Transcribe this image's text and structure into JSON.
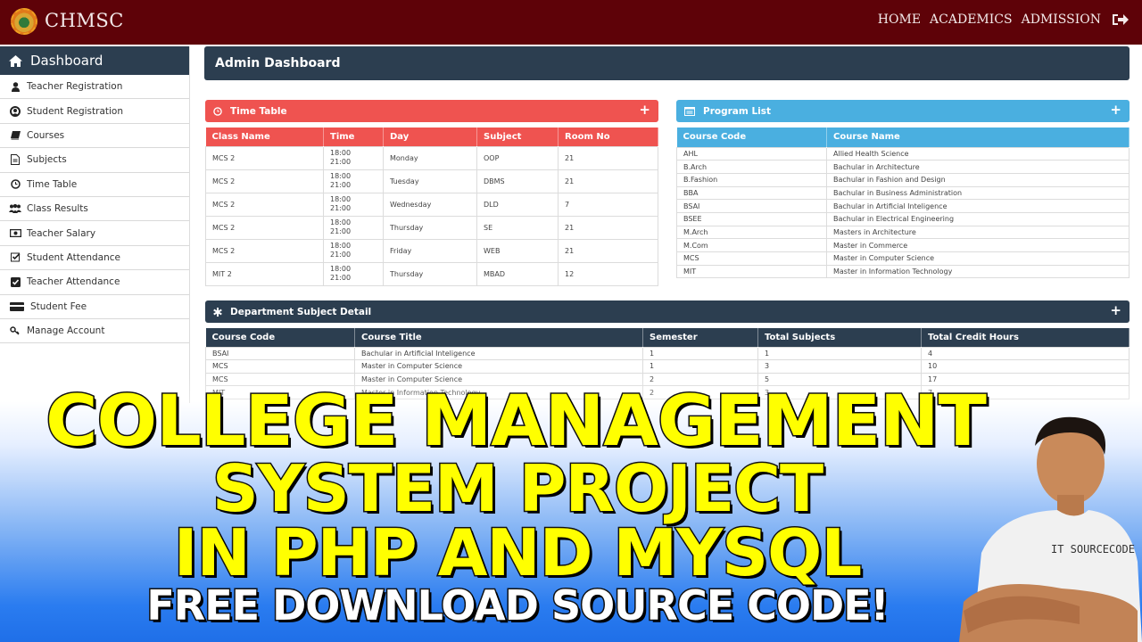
{
  "navbar": {
    "brand": "CHMSC",
    "links": [
      "HOME",
      "ACADEMICS",
      "ADMISSION"
    ],
    "logout_icon": "sign-out-icon",
    "background": "#5e0208"
  },
  "sidebar": {
    "header": {
      "label": "Dashboard",
      "icon": "home-icon"
    },
    "items": [
      {
        "label": "Teacher Registration",
        "icon": "user-icon"
      },
      {
        "label": "Student Registration",
        "icon": "user-circle-icon"
      },
      {
        "label": "Courses",
        "icon": "book-icon"
      },
      {
        "label": "Subjects",
        "icon": "file-text-icon"
      },
      {
        "label": "Time Table",
        "icon": "clock-icon"
      },
      {
        "label": "Class Results",
        "icon": "users-icon"
      },
      {
        "label": "Teacher Salary",
        "icon": "money-icon"
      },
      {
        "label": "Student Attendance",
        "icon": "check-square-outline-icon"
      },
      {
        "label": "Teacher Attendance",
        "icon": "check-square-icon"
      },
      {
        "label": "Student Fee",
        "icon": "credit-card-icon"
      },
      {
        "label": "Manage Account",
        "icon": "key-icon"
      }
    ]
  },
  "main": {
    "page_title": "Admin Dashboard",
    "timetable": {
      "title": "Time Table",
      "icon": "clock-icon",
      "add_icon": "plus-icon",
      "columns": [
        "Class Name",
        "Time",
        "Day",
        "Subject",
        "Room No"
      ],
      "rows": [
        [
          "MCS 2",
          "18:00",
          "21:00",
          "Monday",
          "OOP",
          "21"
        ],
        [
          "MCS 2",
          "18:00",
          "21:00",
          "Tuesday",
          "DBMS",
          "21"
        ],
        [
          "MCS 2",
          "18:00",
          "21:00",
          "Wednesday",
          "DLD",
          "7"
        ],
        [
          "MCS 2",
          "18:00",
          "21:00",
          "Thursday",
          "SE",
          "21"
        ],
        [
          "MCS 2",
          "18:00",
          "21:00",
          "Friday",
          "WEB",
          "21"
        ],
        [
          "MIT 2",
          "18:00",
          "21:00",
          "Thursday",
          "MBAD",
          "12"
        ]
      ]
    },
    "program_list": {
      "title": "Program List",
      "icon": "list-alt-icon",
      "add_icon": "plus-icon",
      "columns": [
        "Course Code",
        "Course Name"
      ],
      "rows": [
        [
          "AHL",
          "Allied Health Science"
        ],
        [
          "B.Arch",
          "Bachular in Architecture"
        ],
        [
          "B.Fashion",
          "Bachular in Fashion and Design"
        ],
        [
          "BBA",
          "Bachular in Business Administration"
        ],
        [
          "BSAI",
          "Bachular in Artificial Inteligence"
        ],
        [
          "BSEE",
          "Bachular in Electrical Engineering"
        ],
        [
          "M.Arch",
          "Masters in Architecture"
        ],
        [
          "M.Com",
          "Master in Commerce"
        ],
        [
          "MCS",
          "Master in Computer Science"
        ],
        [
          "MIT",
          "Master in Information Technology"
        ]
      ]
    },
    "dept_subject": {
      "title": "Department Subject Detail",
      "icon": "asterisk-icon",
      "add_icon": "plus-icon",
      "columns": [
        "Course Code",
        "Course Title",
        "Semester",
        "Total Subjects",
        "Total Credit Hours"
      ],
      "rows": [
        [
          "BSAI",
          "Bachular in Artificial Inteligence",
          "1",
          "1",
          "4"
        ],
        [
          "MCS",
          "Master in Computer Science",
          "1",
          "3",
          "10"
        ],
        [
          "MCS",
          "Master in Computer Science",
          "2",
          "5",
          "17"
        ],
        [
          "MIT",
          "Master in Information Technology",
          "2",
          "3",
          "7"
        ]
      ]
    }
  },
  "overlay": {
    "line1": "COLLEGE MANAGEMENT",
    "line2": "SYSTEM PROJECT",
    "line3": "IN PHP AND MYSQL",
    "line4": "FREE DOWNLOAD SOURCE CODE!",
    "shirt_text": "IT SOURCECODE",
    "headline_color": "#ffff00"
  }
}
